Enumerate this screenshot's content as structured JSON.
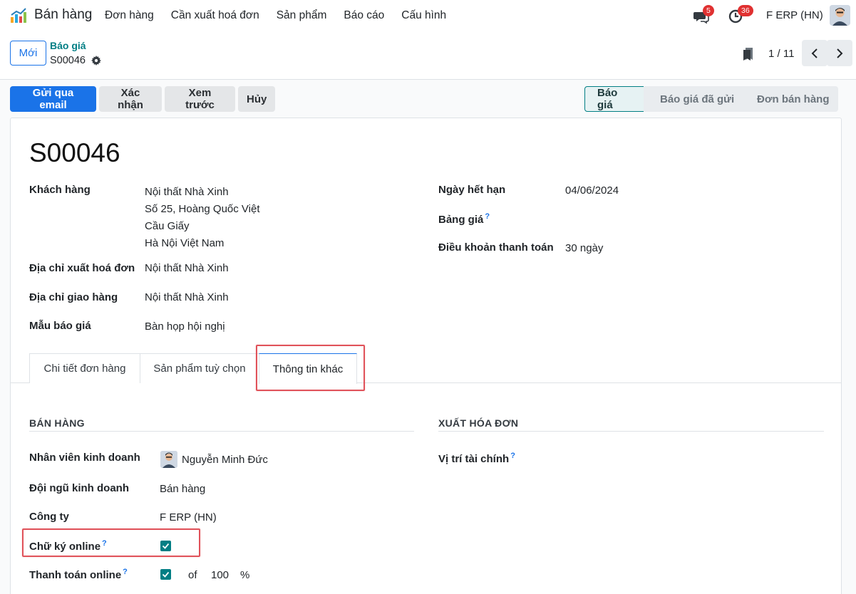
{
  "nav": {
    "app_name": "Bán hàng",
    "menu": [
      "Đơn hàng",
      "Cần xuất hoá đơn",
      "Sản phẩm",
      "Báo cáo",
      "Cấu hình"
    ],
    "messages_count": "5",
    "activities_count": "36",
    "company": "F ERP (HN)"
  },
  "control_panel": {
    "new_label": "Mới",
    "breadcrumb_parent": "Báo giá",
    "breadcrumb_current": "S00046",
    "pager_value": "1 / 11"
  },
  "actions": [
    "Gửi qua email",
    "Xác nhận",
    "Xem trước",
    "Hủy"
  ],
  "status_steps": [
    "Báo giá",
    "Báo giá đã gửi",
    "Đơn bán hàng"
  ],
  "form": {
    "title": "S00046",
    "customer_label": "Khách hàng",
    "customer_lines": [
      "Nội thất Nhà Xinh",
      "Số 25, Hoàng Quốc Việt",
      "Cầu Giấy",
      "Hà Nội Việt Nam"
    ],
    "invoice_addr_label": "Địa chỉ xuất hoá đơn",
    "invoice_addr": "Nội thất Nhà Xinh",
    "delivery_addr_label": "Địa chỉ giao hàng",
    "delivery_addr": "Nội thất Nhà Xinh",
    "template_label": "Mẫu báo giá",
    "template": "Bàn họp hội nghị",
    "expiry_label": "Ngày hết hạn",
    "expiry": "04/06/2024",
    "pricelist_label": "Bảng giá",
    "payment_terms_label": "Điều khoản thanh toán",
    "payment_terms": "30 ngày"
  },
  "tabs": [
    "Chi tiết đơn hàng",
    "Sản phẩm tuỳ chọn",
    "Thông tin khác"
  ],
  "other_info": {
    "sales_title": "BÁN HÀNG",
    "invoicing_title": "XUẤT HÓA ĐƠN",
    "salesperson_label": "Nhân viên kinh doanh",
    "salesperson": "Nguyễn Minh Đức",
    "team_label": "Đội ngũ kinh doanh",
    "team": "Bán hàng",
    "company_label": "Công ty",
    "company": "F ERP (HN)",
    "signature_label": "Chữ ký online",
    "payment_label": "Thanh toán online",
    "of_text": "of",
    "payment_percent": "100",
    "percent_sign": "%",
    "fiscal_position_label": "Vị trí tài chính",
    "help_mark": "?"
  },
  "colors": {
    "primary": "#1a73e8",
    "accent": "#017e84",
    "highlight": "#e0525a"
  }
}
